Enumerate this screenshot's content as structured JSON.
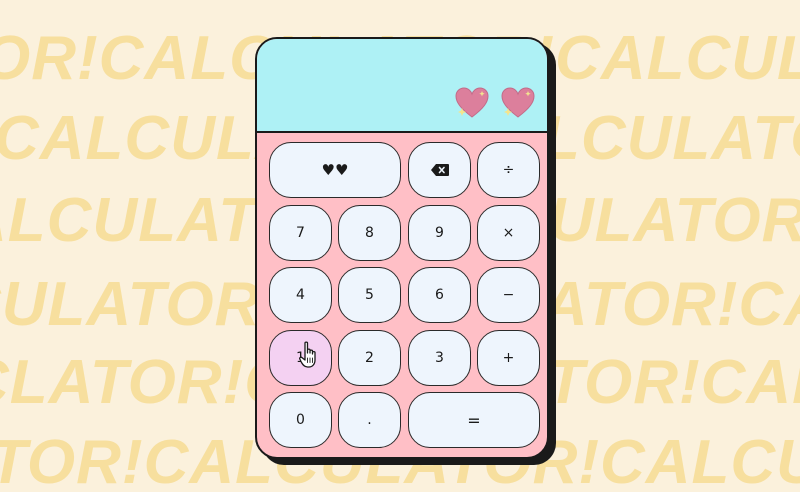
{
  "background": {
    "rows": [
      "OR!CALCULATOR!CALCULATOR!CALC",
      "CALCULATOR!CALCULATOR!CALCULATOR",
      "ALCULATOR!CALCULATOR!CALCULATOR!",
      "CULATOR!CALCULATOR!CALCULATOR!C",
      "CLATOR!CALCULATOR!CALCULATOR!CA",
      "ATOR!CALCULATOR!CALCULATOR!CALCU"
    ],
    "color": "#f7df9e"
  },
  "display": {
    "icons": [
      "sparkle-heart-icon",
      "sparkle-heart-icon"
    ],
    "heart_color": "#dc7f9c",
    "sparkle_color": "#f3e58f"
  },
  "keys": {
    "clear": "♥♥",
    "backspace": "backspace-icon",
    "divide": "÷",
    "seven": "7",
    "eight": "8",
    "nine": "9",
    "multiply": "×",
    "four": "4",
    "five": "5",
    "six": "6",
    "minus": "−",
    "one": "1",
    "two": "2",
    "three": "3",
    "plus": "+",
    "zero": "0",
    "dot": ".",
    "equals": "="
  },
  "colors": {
    "body": "#ffbfc6",
    "screen": "#aef1f5",
    "key": "#eef5fd",
    "key_hover": "#f4d1f2"
  }
}
